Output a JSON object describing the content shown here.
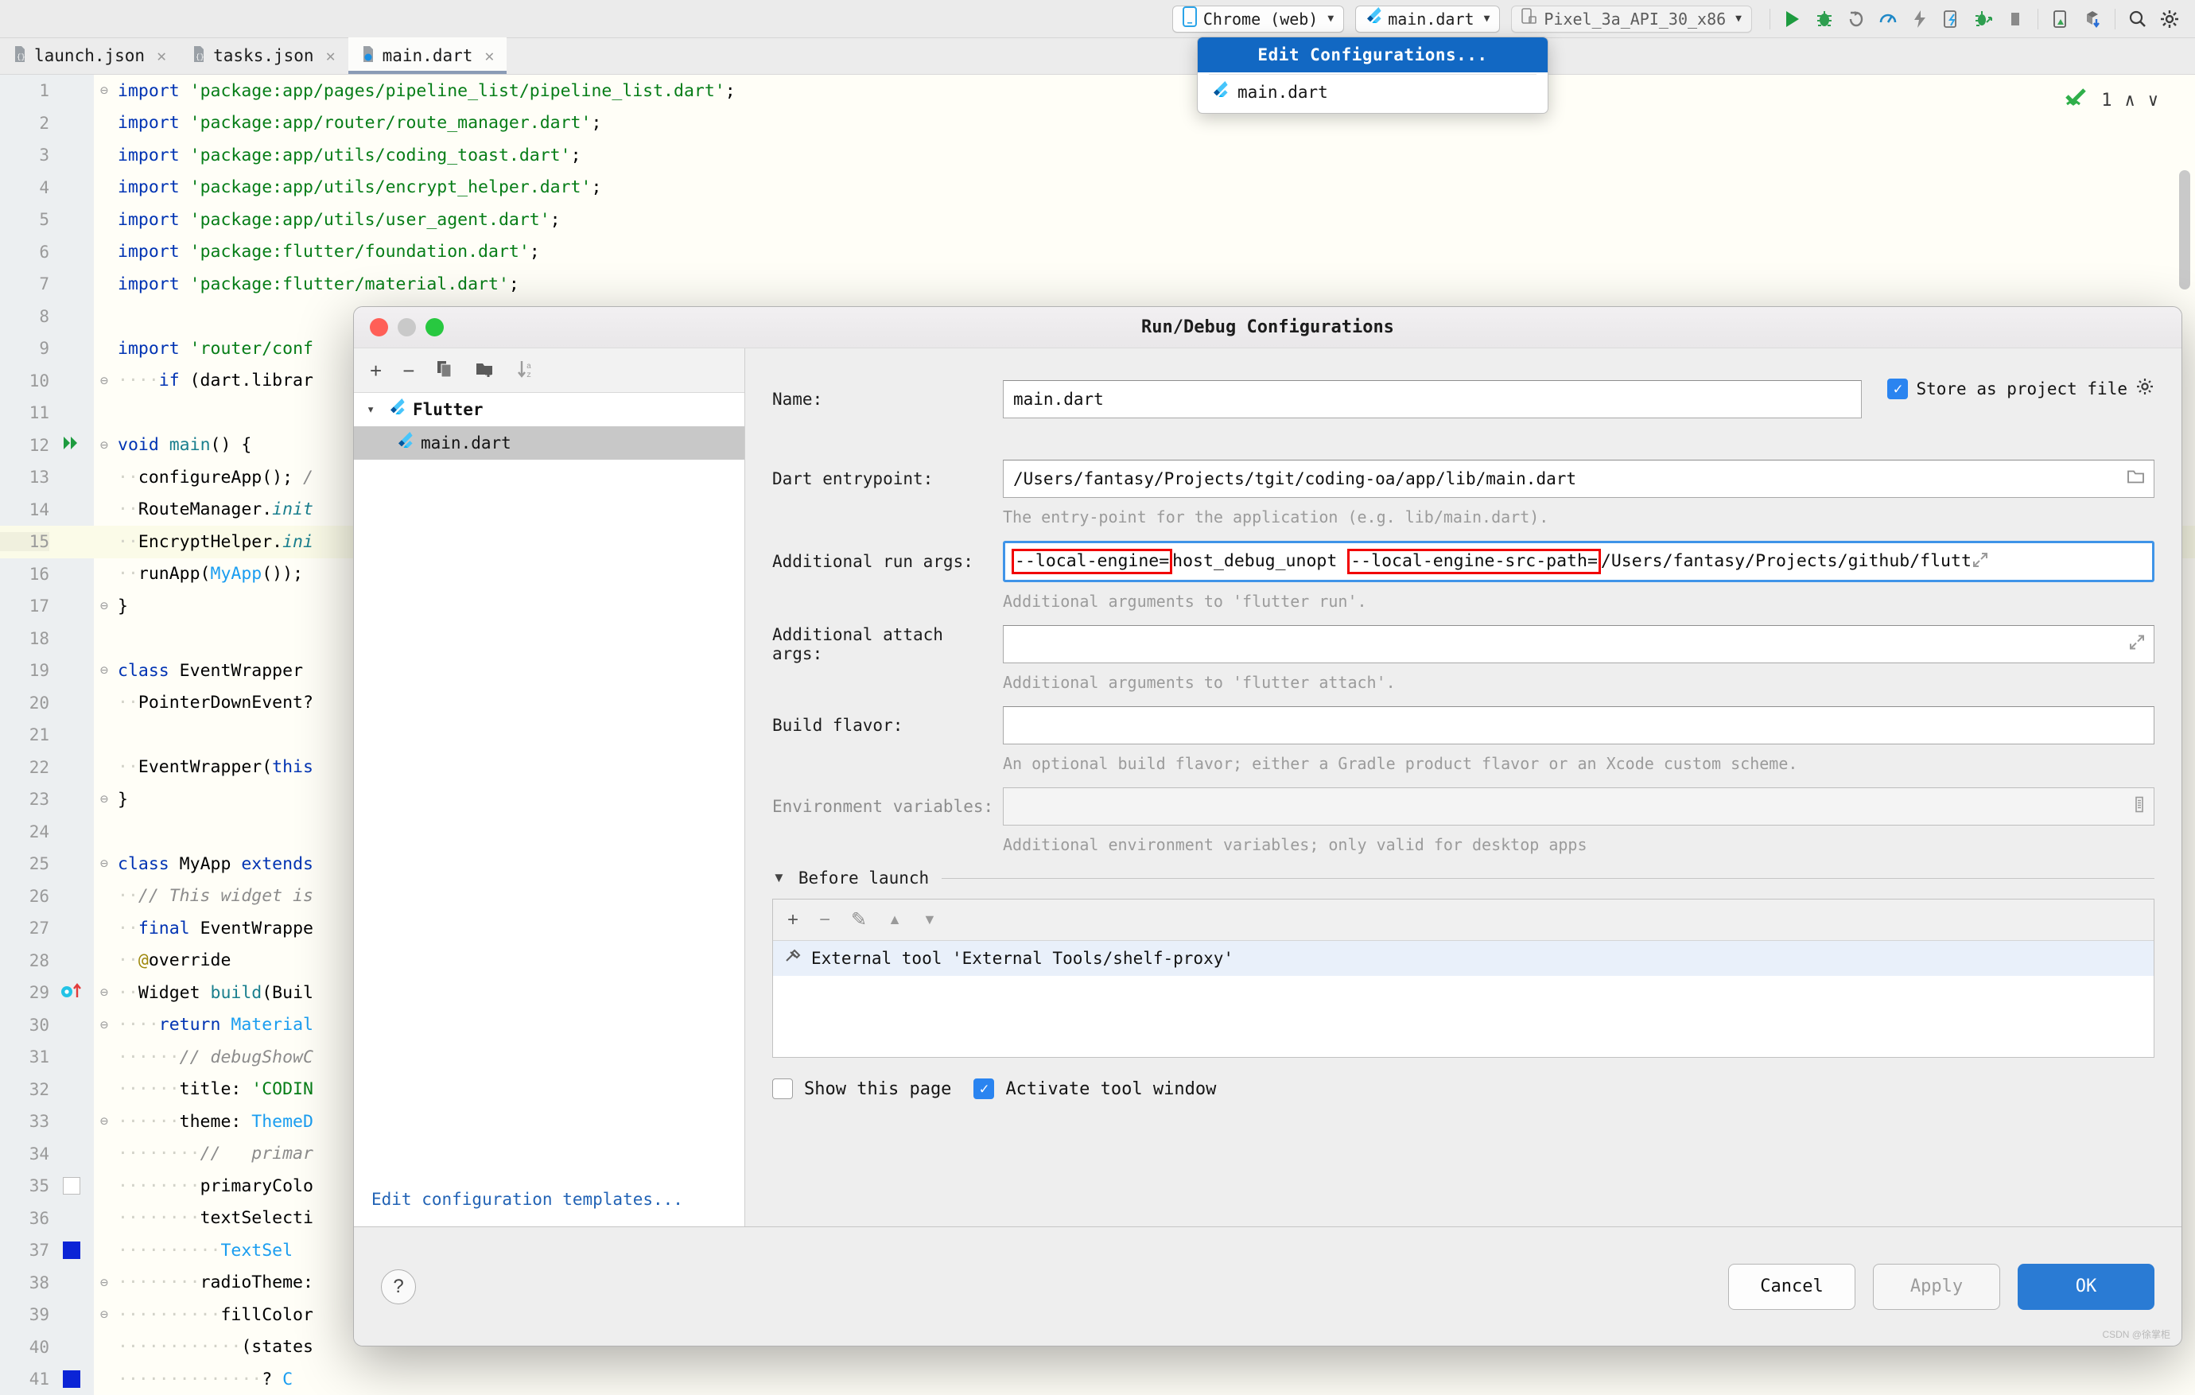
{
  "toolbar": {
    "device_selector": {
      "label": "Chrome (web)",
      "icon": "mobile-icon"
    },
    "run_config_selector": {
      "label": "main.dart",
      "icon": "flutter-icon"
    },
    "emulator_selector": {
      "label": "Pixel_3a_API_30_x86",
      "icon": "device-icon"
    },
    "actions": [
      {
        "name": "run-button",
        "glyph": "▶",
        "color": "#1d9b3f"
      },
      {
        "name": "debug-button",
        "glyph": "🐞",
        "color": "#2e9e4f"
      },
      {
        "name": "run-with-coverage-button",
        "glyph": "↻",
        "color": "#7a7a7a"
      },
      {
        "name": "profile-button",
        "glyph": "◔",
        "color": "#1e88c7"
      },
      {
        "name": "hot-reload-button",
        "glyph": "⚡",
        "color": "#777777"
      },
      {
        "name": "open-devtools-button",
        "glyph": "▯",
        "color": "#3c7fb1"
      },
      {
        "name": "attach-debugger-button",
        "glyph": "🐞",
        "color": "#2e9e4f"
      },
      {
        "name": "stop-button",
        "glyph": "■",
        "color": "#8a8a8a"
      },
      {
        "name": "device-manager-button",
        "glyph": "▭",
        "color": "#3aa655"
      },
      {
        "name": "pub-get-button",
        "glyph": "⬇",
        "color": "#2a6fd6"
      },
      {
        "name": "search-everywhere-button",
        "glyph": "🔍",
        "color": "#3c3c3c"
      },
      {
        "name": "settings-button",
        "glyph": "⚙",
        "color": "#3c3c3c"
      }
    ]
  },
  "run_config_popup": {
    "selected_item": "Edit Configurations...",
    "items": [
      {
        "label": "main.dart",
        "icon": "flutter-icon"
      }
    ]
  },
  "editor_tabs": [
    {
      "label": "launch.json",
      "icon": "json-file-icon",
      "active": false
    },
    {
      "label": "tasks.json",
      "icon": "json-file-icon",
      "active": false
    },
    {
      "label": "main.dart",
      "icon": "dart-file-icon",
      "active": true
    }
  ],
  "inspection_widget": {
    "count": "1",
    "up": "∧",
    "down": "∨"
  },
  "code_lines": [
    {
      "n": "1",
      "fold": "⊖",
      "html": "<span class='k'>import</span> <span class='s'>'package:app/pages/pipeline_list/pipeline_list.dart'</span>;"
    },
    {
      "n": "2",
      "fold": "",
      "html": "<span class='k'>import</span> <span class='s'>'package:app/router/route_manager.dart'</span>;"
    },
    {
      "n": "3",
      "fold": "",
      "html": "<span class='k'>import</span> <span class='s'>'package:app/utils/coding_toast.dart'</span>;"
    },
    {
      "n": "4",
      "fold": "",
      "html": "<span class='k'>import</span> <span class='s'>'package:app/utils/encrypt_helper.dart'</span>;"
    },
    {
      "n": "5",
      "fold": "",
      "html": "<span class='k'>import</span> <span class='s'>'package:app/utils/user_agent.dart'</span>;"
    },
    {
      "n": "6",
      "fold": "",
      "html": "<span class='k'>import</span> <span class='s'>'package:flutter/foundation.dart'</span>;"
    },
    {
      "n": "7",
      "fold": "",
      "html": "<span class='k'>import</span> <span class='s'>'package:flutter/material.dart'</span>;"
    },
    {
      "n": "8",
      "fold": "",
      "html": ""
    },
    {
      "n": "9",
      "fold": "",
      "html": "<span class='k'>import</span> <span class='s'>'router/conf</span>"
    },
    {
      "n": "10",
      "fold": "⊖",
      "html": "<span class='dot'>····</span><span class='k'>if</span> (dart.librar"
    },
    {
      "n": "11",
      "fold": "",
      "html": ""
    },
    {
      "n": "12",
      "fold": "⊖",
      "mark": "run",
      "html": "<span class='k'>void</span> <span class='t'>main</span>() {"
    },
    {
      "n": "13",
      "fold": "",
      "html": "<span class='dot'>··</span>configureApp(); <span class='c'>/</span>"
    },
    {
      "n": "14",
      "fold": "",
      "html": "<span class='dot'>··</span>RouteManager.<span class='t' style='font-style:italic'>init</span>"
    },
    {
      "n": "15",
      "fold": "",
      "hl": true,
      "html": "<span class='dot'>··</span>EncryptHelper.<span class='t' style='font-style:italic'>ini</span>"
    },
    {
      "n": "16",
      "fold": "",
      "html": "<span class='dot'>··</span>runApp(<span class='cl'>MyApp</span>());"
    },
    {
      "n": "17",
      "fold": "⊖",
      "html": "}"
    },
    {
      "n": "18",
      "fold": "",
      "html": ""
    },
    {
      "n": "19",
      "fold": "⊖",
      "html": "<span class='k'>class</span> EventWrapper "
    },
    {
      "n": "20",
      "fold": "",
      "html": "<span class='dot'>··</span>PointerDownEvent?"
    },
    {
      "n": "21",
      "fold": "",
      "html": ""
    },
    {
      "n": "22",
      "fold": "",
      "html": "<span class='dot'>··</span>EventWrapper(<span class='k'>this</span>"
    },
    {
      "n": "23",
      "fold": "⊖",
      "html": "}"
    },
    {
      "n": "24",
      "fold": "",
      "html": ""
    },
    {
      "n": "25",
      "fold": "⊖",
      "html": "<span class='k'>class</span> MyApp <span class='k'>extends</span>"
    },
    {
      "n": "26",
      "fold": "",
      "html": "<span class='dot'>··</span><span class='c'>// This widget is</span>"
    },
    {
      "n": "27",
      "fold": "",
      "html": "<span class='dot'>··</span><span class='k'>final</span> EventWrappe"
    },
    {
      "n": "28",
      "fold": "",
      "html": "<span class='dot'>··</span><span class='an'>@</span>override"
    },
    {
      "n": "29",
      "fold": "⊖",
      "mark": "override",
      "html": "<span class='dot'>··</span>Widget <span class='t'>build</span>(Buil"
    },
    {
      "n": "30",
      "fold": "⊖",
      "html": "<span class='dot'>····</span><span class='k'>return</span> <span class='cl'>Material</span>"
    },
    {
      "n": "31",
      "fold": "",
      "html": "<span class='dot'>······</span><span class='c'>// debugShowC</span>"
    },
    {
      "n": "32",
      "fold": "",
      "html": "<span class='dot'>······</span>title: <span class='s'>'CODIN</span>"
    },
    {
      "n": "33",
      "fold": "⊖",
      "html": "<span class='dot'>······</span>theme: <span class='cl'>ThemeD</span>"
    },
    {
      "n": "34",
      "fold": "",
      "html": "<span class='dot'>········</span><span class='c'>//   primar</span>"
    },
    {
      "n": "35",
      "fold": "",
      "swatch": "white",
      "html": "<span class='dot'>········</span>primaryColo"
    },
    {
      "n": "36",
      "fold": "",
      "html": "<span class='dot'>········</span>textSelecti"
    },
    {
      "n": "37",
      "fold": "",
      "swatch": "blue",
      "html": "<span class='dot'>··········</span><span class='cl'>TextSel</span>"
    },
    {
      "n": "38",
      "fold": "⊖",
      "html": "<span class='dot'>········</span>radioTheme:"
    },
    {
      "n": "39",
      "fold": "⊖",
      "html": "<span class='dot'>··········</span>fillColor"
    },
    {
      "n": "40",
      "fold": "",
      "html": "<span class='dot'>············</span>(states"
    },
    {
      "n": "41",
      "fold": "",
      "swatch": "blue",
      "html": "<span class='dot'>··············</span>? <span class='cl'>C</span>"
    }
  ],
  "dialog": {
    "title": "Run/Debug Configurations",
    "tree": {
      "toolbar_icons": [
        "add-icon",
        "remove-icon",
        "copy-icon",
        "new-folder-icon",
        "sort-alphabetically-icon"
      ],
      "group": {
        "label": "Flutter",
        "icon": "flutter-icon",
        "expanded": true
      },
      "items": [
        {
          "label": "main.dart",
          "icon": "flutter-icon",
          "selected": true
        }
      ],
      "templates_link": "Edit configuration templates..."
    },
    "store_as_project_file": {
      "label": "Store as project file",
      "checked": true,
      "gear_icon": "gear-icon"
    },
    "fields": {
      "name": {
        "label": "Name:",
        "value": "main.dart"
      },
      "dart_entrypoint": {
        "label": "Dart entrypoint:",
        "value": "/Users/fantasy/Projects/tgit/coding-oa/app/lib/main.dart",
        "hint": "The entry-point for the application (e.g. lib/main.dart).",
        "browse_icon": "folder-icon"
      },
      "additional_run_args": {
        "label": "Additional run args:",
        "hint": "Additional arguments to 'flutter run'.",
        "focused": true,
        "segments": [
          {
            "text": "--local-engine=",
            "highlighted": true
          },
          {
            "text": "host_debug_unopt ",
            "highlighted": false
          },
          {
            "text": "--local-engine-src-path=",
            "highlighted": true
          },
          {
            "text": "/Users/fantasy/Projects/github/flutt",
            "highlighted": false
          }
        ],
        "expand_icon": "expand-icon"
      },
      "additional_attach_args": {
        "label": "Additional attach args:",
        "value": "",
        "hint": "Additional arguments to 'flutter attach'.",
        "expand_icon": "expand-icon"
      },
      "build_flavor": {
        "label": "Build flavor:",
        "value": "",
        "hint": "An optional build flavor; either a Gradle product flavor or an Xcode custom scheme."
      },
      "environment_variables": {
        "label": "Environment variables:",
        "value": "",
        "hint": "Additional environment variables; only valid for desktop apps",
        "browse_icon": "list-icon",
        "disabled": true
      }
    },
    "before_launch": {
      "title": "Before launch",
      "collapse_icon": "triangle-down-icon",
      "toolbar_icons": [
        "add-icon",
        "remove-icon",
        "edit-icon",
        "move-up-icon",
        "move-down-icon"
      ],
      "items": [
        {
          "label": "External tool 'External Tools/shelf-proxy'",
          "icon": "external-tool-icon"
        }
      ]
    },
    "options": [
      {
        "label": "Show this page",
        "checked": false,
        "name": "show-this-page-checkbox"
      },
      {
        "label": "Activate tool window",
        "checked": true,
        "name": "activate-tool-window-checkbox"
      }
    ],
    "footer": {
      "help": "?",
      "cancel": "Cancel",
      "apply": "Apply",
      "ok": "OK"
    }
  },
  "watermark": "CSDN @徐掌柜"
}
